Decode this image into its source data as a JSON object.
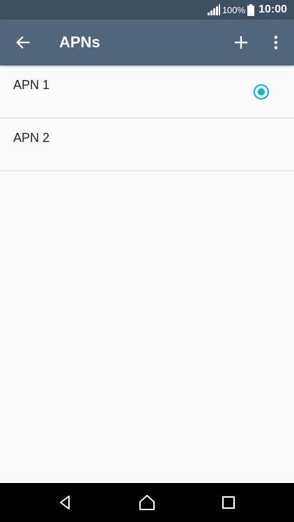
{
  "status_bar": {
    "battery_percent": "100%",
    "time": "10:00",
    "icons": [
      "signal-icon",
      "battery-icon"
    ]
  },
  "app_bar": {
    "title": "APNs",
    "icons": [
      "back-arrow-icon",
      "plus-icon",
      "more-vertical-icon"
    ]
  },
  "apn_list": [
    {
      "name": "APN 1",
      "selected": true
    },
    {
      "name": "APN 2",
      "selected": false
    }
  ],
  "nav_bar": {
    "icons": [
      "nav-back-icon",
      "nav-home-icon",
      "nav-recent-icon"
    ]
  },
  "colors": {
    "status_bar": "#3d5062",
    "app_bar": "#4f667d",
    "accent": "#13b5c7",
    "background": "#fafafa",
    "divider": "#dcdcdc"
  }
}
